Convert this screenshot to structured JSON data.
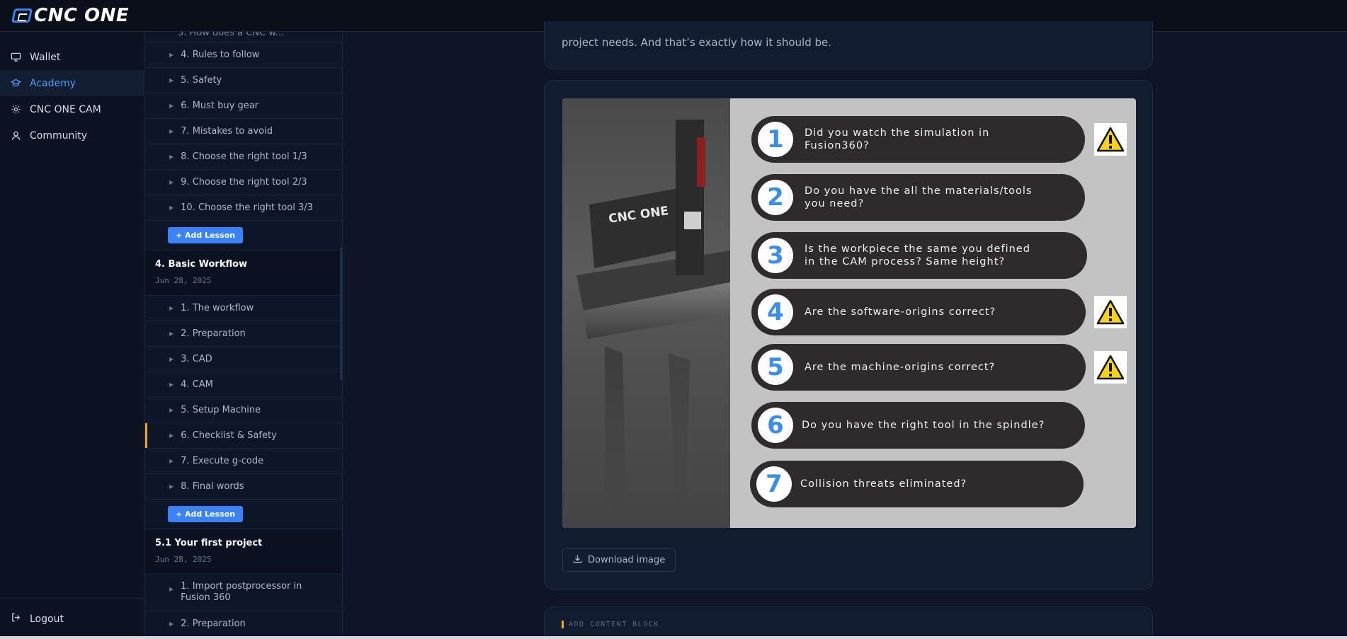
{
  "app": {
    "logo_text": "CNC ONE",
    "accent_color": "#3b82f6",
    "highlight_color": "#f5a623"
  },
  "nav": {
    "items": [
      {
        "label": "Wallet",
        "icon": "monitor-icon",
        "active": false
      },
      {
        "label": "Academy",
        "icon": "graduation-cap-icon",
        "active": true
      },
      {
        "label": "CNC ONE CAM",
        "icon": "sun-gear-icon",
        "active": false
      },
      {
        "label": "Community",
        "icon": "user-icon",
        "active": false
      }
    ],
    "logout_label": "Logout"
  },
  "lessons": {
    "partial_item": "3. How does a CNC w...",
    "section3_items": [
      "4. Rules to follow",
      "5. Safety",
      "6. Must buy gear",
      "7. Mistakes to avoid",
      "8. Choose the right tool 1/3",
      "9. Choose the right tool 2/3",
      "10. Choose the right tool 3/3"
    ],
    "add_lesson_label": "+ Add Lesson",
    "chapter4": {
      "title": "4. Basic Workflow",
      "date": "Jun 28, 2025"
    },
    "chapter4_items": [
      "1. The workflow",
      "2. Preparation",
      "3. CAD",
      "4. CAM",
      "5. Setup Machine",
      "6. Checklist & Safety",
      "7. Execute g-code",
      "8. Final words"
    ],
    "chapter5": {
      "title": "5.1 Your first project",
      "date": "Jun 28, 2025"
    },
    "chapter5_items": [
      "1. Import postprocessor in Fusion 360",
      "2. Preparation"
    ]
  },
  "content": {
    "intro_tail": "project needs. And that’s exactly how it should be.",
    "image": {
      "machine_label": "CNC ONE",
      "checklist": [
        {
          "num": "1",
          "line1": "Did you watch the simulation in",
          "line2": "Fusion360?",
          "warning": true
        },
        {
          "num": "2",
          "line1": "Do you have the all the materials/tools",
          "line2": "you need?",
          "warning": false
        },
        {
          "num": "3",
          "line1": "Is the workpiece the same you defined",
          "line2": "in the CAM process? Same height?",
          "warning": false
        },
        {
          "num": "4",
          "line1": "Are the software-origins correct?",
          "line2": "",
          "warning": true
        },
        {
          "num": "5",
          "line1": "Are the machine-origins correct?",
          "line2": "",
          "warning": true
        },
        {
          "num": "6",
          "line1": "Do you have the right tool in the spindle?",
          "line2": "",
          "warning": false
        },
        {
          "num": "7",
          "line1": "Collision threats eliminated?",
          "line2": "",
          "warning": false
        }
      ]
    },
    "download_label": "Download image",
    "add_content_block_label": "ADD CONTENT BLOCK"
  }
}
